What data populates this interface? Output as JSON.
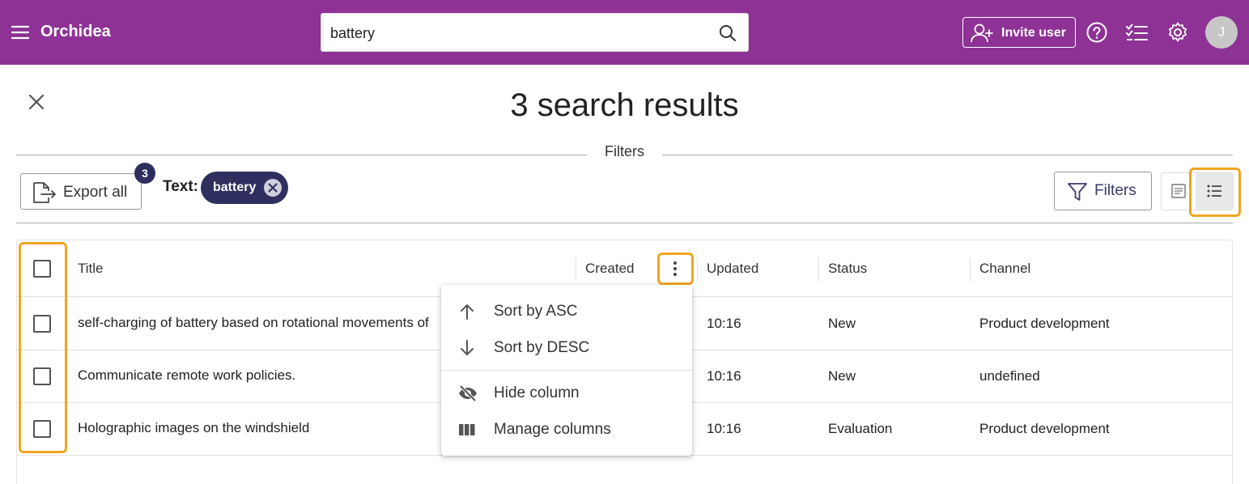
{
  "header": {
    "app_title": "Orchidea",
    "search_value": "battery",
    "invite_label": "Invite user",
    "avatar_initial": "J",
    "icons": [
      "menu-icon",
      "search-icon",
      "add-user-icon",
      "help-icon",
      "tasks-icon",
      "gear-icon"
    ]
  },
  "page": {
    "title": "3 search results",
    "filters_label": "Filters"
  },
  "toolbar": {
    "export_label": "Export all",
    "export_count": "3",
    "text_label": "Text:",
    "chip_value": "battery",
    "filters_button_label": "Filters"
  },
  "table": {
    "columns": [
      "Title",
      "Created",
      "Updated",
      "Status",
      "Channel"
    ],
    "rows": [
      {
        "title": "self-charging of battery based on rotational movements of",
        "updated": "10:16",
        "status": "New",
        "channel": "Product development"
      },
      {
        "title": "Communicate remote work policies.",
        "updated": "10:16",
        "status": "New",
        "channel": "undefined"
      },
      {
        "title": "Holographic images on the windshield",
        "updated": "10:16",
        "status": "Evaluation",
        "channel": "Product development"
      }
    ]
  },
  "column_menu": {
    "items": [
      "Sort by ASC",
      "Sort by DESC",
      "Hide column",
      "Manage columns"
    ]
  },
  "colors": {
    "header_bg": "#8e3296",
    "chip_bg": "#2f2f5f",
    "highlight": "#f0a524"
  }
}
